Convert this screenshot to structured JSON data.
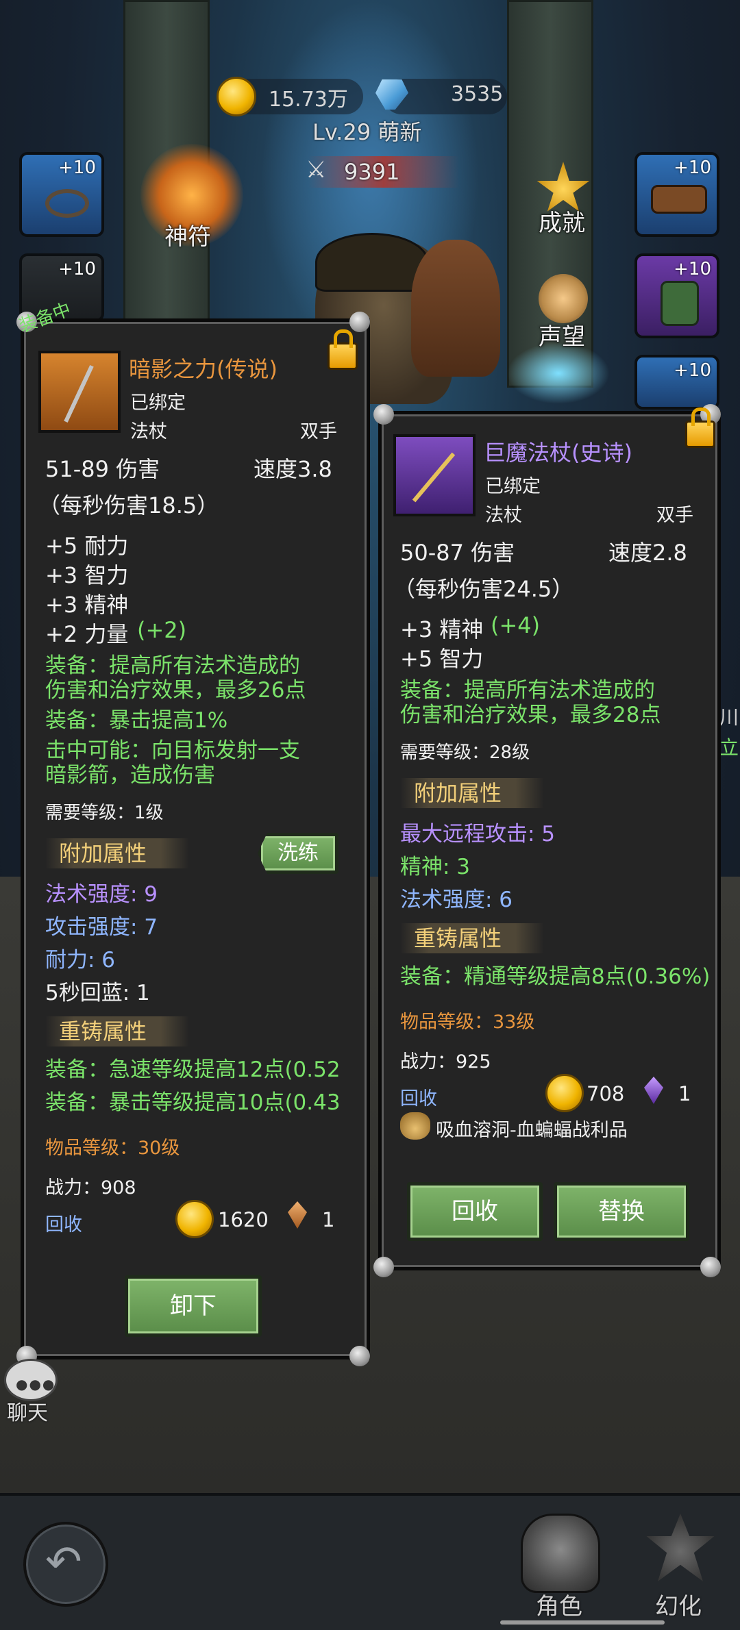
{
  "header": {
    "gold": "15.73万",
    "gems": "3535",
    "level_name": "Lv.29 萌新",
    "power": "9391"
  },
  "side_icons": {
    "rune_label": "神符",
    "achievement_label": "成就",
    "reputation_label": "声望",
    "slot_levels": [
      "+10",
      "+10",
      "+10",
      "+10",
      "+10"
    ],
    "edge_text_1": "川",
    "edge_text_2": "立"
  },
  "equipped": {
    "badge": "装备中",
    "name": "暗影之力(传说)",
    "bound": "已绑定",
    "type": "法杖",
    "hand": "双手",
    "damage": "51-89 伤害",
    "speed": "速度3.8",
    "dps": "（每秒伤害18.5）",
    "stats": [
      {
        "text": "+5 耐力",
        "extra": ""
      },
      {
        "text": "+3 智力",
        "extra": ""
      },
      {
        "text": "+3 精神",
        "extra": ""
      },
      {
        "text": "+2 力量",
        "extra": "(+2)"
      }
    ],
    "effects": [
      "装备：提高所有法术造成的",
      "伤害和治疗效果，最多26点",
      "装备：暴击提高1%",
      "击中可能：向目标发射一支",
      "暗影箭，造成伤害"
    ],
    "req_level": "需要等级：1级",
    "bonus_header": "附加属性",
    "wash_button": "洗练",
    "bonus": [
      "法术强度: 9",
      "攻击强度: 7",
      "耐力: 6",
      "5秒回蓝: 1"
    ],
    "reforge_header": "重铸属性",
    "reforge": [
      "装备：急速等级提高12点(0.52",
      "装备：暴击等级提高10点(0.43"
    ],
    "item_level": "物品等级：30级",
    "power": "战力：908",
    "recycle": "回收",
    "recycle_gold": "1620",
    "recycle_shard": "1",
    "unequip_button": "卸下"
  },
  "compare": {
    "name": "巨魔法杖(史诗)",
    "bound": "已绑定",
    "type": "法杖",
    "hand": "双手",
    "damage": "50-87 伤害",
    "speed": "速度2.8",
    "dps": "（每秒伤害24.5）",
    "stat1": "+3 精神",
    "stat1_extra": "(+4)",
    "stat2": "+5 智力",
    "effects": [
      "装备：提高所有法术造成的",
      "伤害和治疗效果，最多28点"
    ],
    "req_level": "需要等级：28级",
    "bonus_header": "附加属性",
    "bonus": [
      "最大远程攻击: 5",
      "精神: 3",
      "法术强度: 6"
    ],
    "reforge_header": "重铸属性",
    "reforge": [
      "装备：精通等级提高8点(0.36%)"
    ],
    "item_level": "物品等级：33级",
    "power": "战力：925",
    "recycle": "回收",
    "recycle_gold": "708",
    "recycle_gem": "1",
    "source": "吸血溶洞-血蝙蝠战利品",
    "recycle_button": "回收",
    "replace_button": "替换"
  },
  "chat_label": "聊天",
  "nav": {
    "character": "角色",
    "transform": "幻化"
  },
  "colors": {
    "legendary": "#e9963e",
    "epic": "#b891ff",
    "green": "#7be36a",
    "blue": "#8fb6ff",
    "gold": "#f3d07a"
  }
}
